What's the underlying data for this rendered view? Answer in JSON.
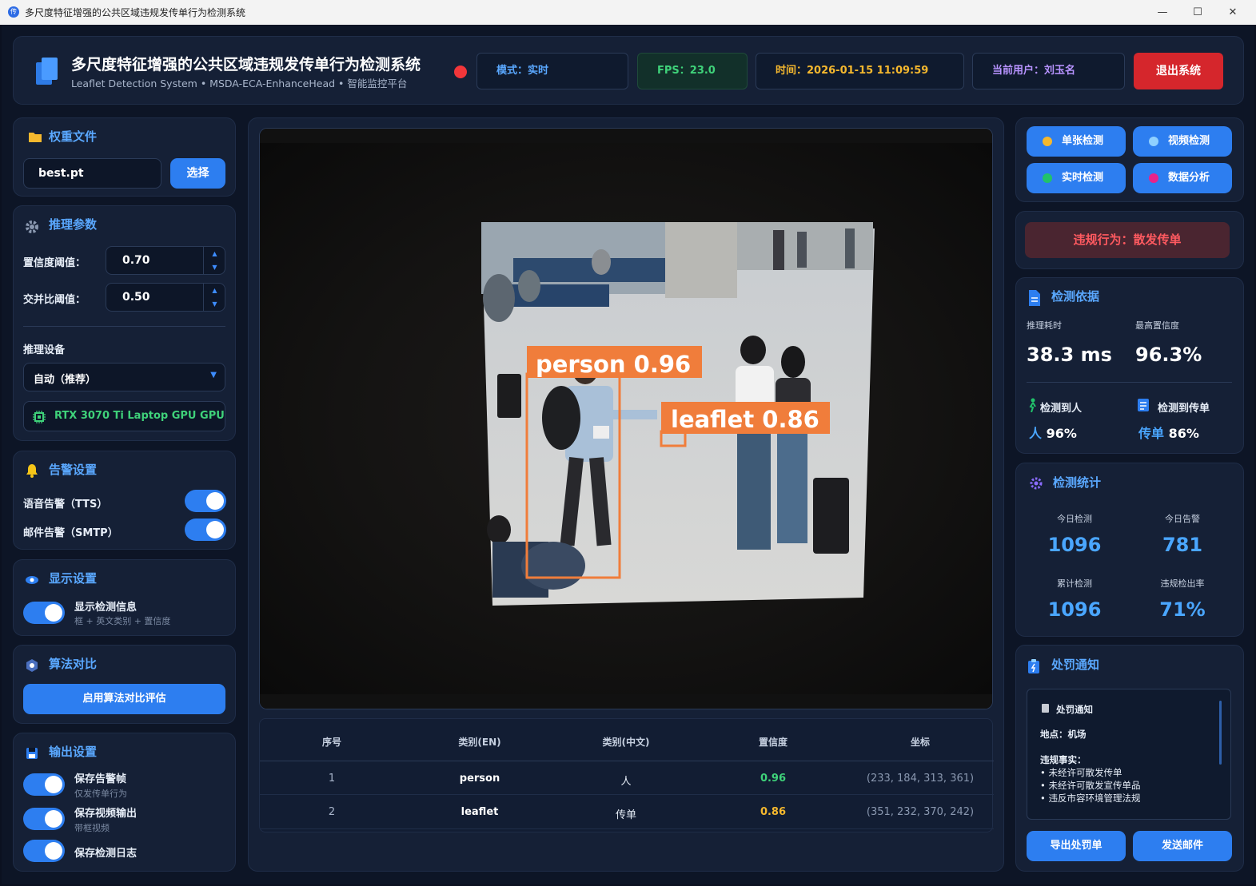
{
  "window": {
    "title": "多尺度特征增强的公共区域违规发传单行为检测系统",
    "minimize": "—",
    "maximize": "☐",
    "close": "✕"
  },
  "header": {
    "title": "多尺度特征增强的公共区域违规发传单行为检测系统",
    "subtitle": "Leaflet Detection System • MSDA-ECA-EnhanceHead • 智能监控平台",
    "mode": "模式：实时",
    "fps": "FPS：23.0",
    "time": "时间：2026-01-15 11:09:59",
    "user": "当前用户：刘玉名",
    "logout": "退出系统"
  },
  "weights": {
    "title": "权重文件",
    "file": "best.pt",
    "select_button": "选择"
  },
  "inference": {
    "title": "推理参数",
    "conf_label": "置信度阈值：",
    "conf_value": "0.70",
    "iou_label": "交并比阈值：",
    "iou_value": "0.50",
    "device_label": "推理设备",
    "device_value": "自动（推荐）",
    "gpu": "RTX 3070 Ti Laptop GPU GPU"
  },
  "alarm": {
    "title": "告警设置",
    "tts_label": "语音告警（TTS）",
    "tts_on": true,
    "smtp_label": "邮件告警（SMTP）",
    "smtp_on": true
  },
  "display": {
    "title": "显示设置",
    "show_label": "显示检测信息",
    "show_desc": "框 + 英文类别 + 置信度"
  },
  "compare": {
    "title": "算法对比",
    "button": "启用算法对比评估"
  },
  "output": {
    "title": "输出设置",
    "items": [
      {
        "label": "保存告警帧",
        "desc": "仅发传单行为"
      },
      {
        "label": "保存视频输出",
        "desc": "带框视频"
      },
      {
        "label": "保存检测日志",
        "desc": ""
      }
    ]
  },
  "detections": {
    "boxes": [
      {
        "label": "person 0.96"
      },
      {
        "label": "leaflet 0.86"
      }
    ],
    "headers": [
      "序号",
      "类别(EN)",
      "类别(中文)",
      "置信度",
      "坐标"
    ],
    "rows": [
      {
        "idx": "1",
        "en": "person",
        "zh": "人",
        "conf": "0.96",
        "conf_color": "#3fd27a",
        "coords": "(233, 184, 313, 361)"
      },
      {
        "idx": "2",
        "en": "leaflet",
        "zh": "传单",
        "conf": "0.86",
        "conf_color": "#f5b82e",
        "coords": "(351, 232, 370, 242)"
      }
    ]
  },
  "modes": [
    {
      "label": "单张检测",
      "dot": "#f5b82e"
    },
    {
      "label": "视频检测",
      "dot": "#8fd0ff"
    },
    {
      "label": "实时检测",
      "dot": "#21c26b"
    },
    {
      "label": "数据分析",
      "dot": "#e8238a"
    }
  ],
  "violation": "违规行为：散发传单",
  "basis": {
    "title": "检测依据",
    "time_label": "推理耗时",
    "time_value": "38.3 ms",
    "maxconf_label": "最高置信度",
    "maxconf_value": "96.3%",
    "person_label": "检测到人",
    "person_value_key": "人",
    "person_value": "96%",
    "leaflet_label": "检测到传单",
    "leaflet_value_key": "传单",
    "leaflet_value": "86%"
  },
  "stats": {
    "title": "检测统计",
    "today_label": "今日检测",
    "today_value": "1096",
    "alarm_label": "今日告警",
    "alarm_value": "781",
    "total_label": "累计检测",
    "total_value": "1096",
    "rate_label": "违规检出率",
    "rate_value": "71%"
  },
  "penalty": {
    "title": "处罚通知",
    "box_title": "处罚通知",
    "location": "地点：机场",
    "facts_title": "违规事实：",
    "facts": [
      "• 未经许可散发传单",
      "• 未经许可散发宣传单品",
      "• 违反市容环境管理法规"
    ],
    "export_button": "导出处罚单",
    "email_button": "发送邮件"
  },
  "colors": {
    "accent": "#2d7ef0",
    "danger": "#d5262c",
    "box": "#f07d3b"
  }
}
